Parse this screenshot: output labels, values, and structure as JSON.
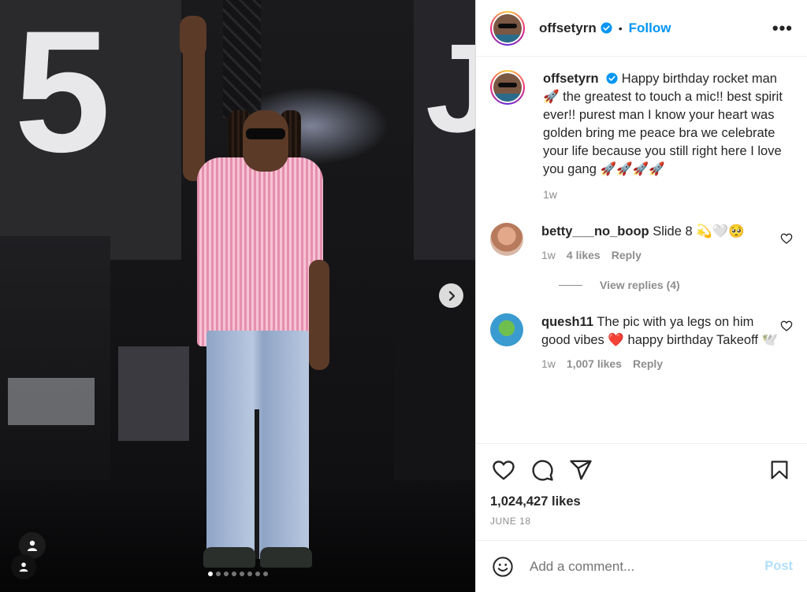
{
  "colors": {
    "accent": "#0095f6",
    "text": "#262626",
    "muted": "#8e8e8e",
    "heart": "#ff3040",
    "post_disabled": "#b2dffc"
  },
  "media": {
    "bg_letters": [
      "5",
      "J"
    ],
    "carousel_dots": 8,
    "active_dot": 0,
    "icons": {
      "next": "chevron-right-icon",
      "tags": "user-tag-icon"
    }
  },
  "header": {
    "username": "offsetyrn",
    "separator": "•",
    "follow_label": "Follow",
    "more_label": "•••"
  },
  "caption": {
    "username": "offsetyrn",
    "text": "Happy birthday rocket man 🚀 the greatest to touch a mic!! best spirit ever!! purest man I know your heart was golden bring me peace bra we celebrate your life because you still right here I love you gang 🚀🚀🚀🚀",
    "time": "1w"
  },
  "comments": [
    {
      "username": "betty___no_boop",
      "text": "Slide 8 💫🤍🥺",
      "time": "1w",
      "likes": "4 likes",
      "reply_label": "Reply",
      "view_replies": "View replies (4)"
    },
    {
      "username": "quesh11",
      "text": "The pic with ya legs on him good vibes ❤️ happy birthday Takeoff 🕊️",
      "time": "1w",
      "likes": "1,007 likes",
      "reply_label": "Reply"
    }
  ],
  "actions": {
    "likes": "1,024,427 likes",
    "date": "JUNE 18",
    "icons": [
      "heart-icon",
      "comment-icon",
      "share-icon",
      "bookmark-icon"
    ]
  },
  "add_comment": {
    "placeholder": "Add a comment...",
    "post_label": "Post"
  }
}
